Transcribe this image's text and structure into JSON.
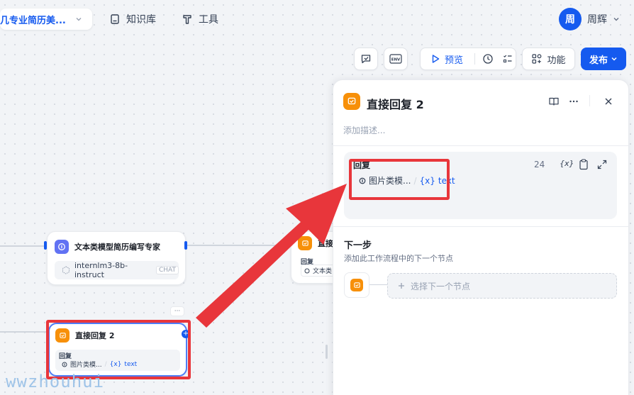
{
  "header": {
    "app_name": "几专业简历美...",
    "nav": [
      {
        "label": "知识库",
        "icon": "book-icon"
      },
      {
        "label": "工具",
        "icon": "tool-icon"
      }
    ],
    "user": {
      "avatar_text": "周",
      "name": "周辉"
    }
  },
  "toolbar": {
    "env_label": "ENV",
    "preview_label": "预览",
    "features_label": "功能",
    "publish_label": "发布"
  },
  "canvas": {
    "llm_node": {
      "title": "文本类模型简历编写专家",
      "model": "internlm3-8b-instruct",
      "model_tag": "CHAT"
    },
    "partial_node": {
      "title": "直接",
      "reply_label": "回复",
      "var_text": "文本类"
    },
    "answer_node": {
      "title": "直接回复 2",
      "reply_label": "回复",
      "var_source": "图片类模...",
      "var_sep": "/",
      "var_name": "text",
      "var_prefix": "{x}"
    },
    "more_label": "···"
  },
  "panel": {
    "title": "直接回复 2",
    "description_placeholder": "添加描述...",
    "reply": {
      "label": "回复",
      "char_count": "24",
      "var_source": "图片类模...",
      "var_sep": "/",
      "var_prefix": "{x}",
      "var_name": "text",
      "var_button": "{x}"
    },
    "next_step": {
      "title": "下一步",
      "description": "添加此工作流程中的下一个节点",
      "select_label": "选择下一个节点"
    }
  },
  "watermark": "wwzhouhui",
  "colors": {
    "accent": "#155aef",
    "highlight": "#e8363b",
    "answer_icon": "#f79009",
    "llm_icon": "#6172f3"
  }
}
